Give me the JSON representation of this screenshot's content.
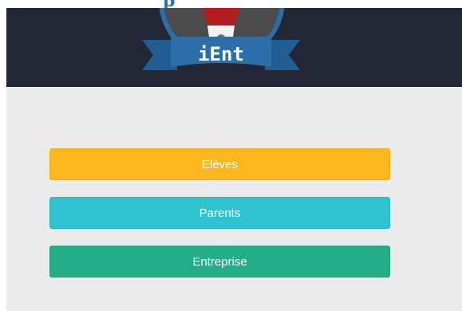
{
  "header": {
    "cut_text": "p",
    "logo_text": "iEnt"
  },
  "buttons": {
    "eleves": "Elèves",
    "parents": "Parents",
    "entreprise": "Entreprise"
  },
  "colors": {
    "header_bg": "#232735",
    "content_bg": "#ebebeb",
    "eleves": "#fbb71c",
    "parents": "#2fc3d0",
    "entreprise": "#23ae88",
    "ribbon": "#2b6ea8"
  }
}
